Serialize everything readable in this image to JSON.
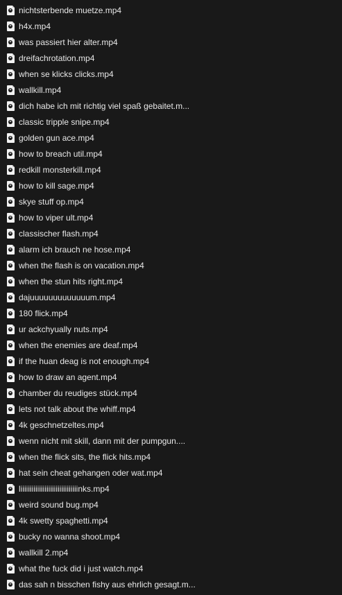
{
  "files": [
    {
      "name": "nichtsterbende muetze.mp4",
      "icon": "video-file-icon"
    },
    {
      "name": "h4x.mp4",
      "icon": "video-file-icon"
    },
    {
      "name": "was passiert hier alter.mp4",
      "icon": "video-file-icon"
    },
    {
      "name": "dreifachrotation.mp4",
      "icon": "video-file-icon"
    },
    {
      "name": "when se klicks clicks.mp4",
      "icon": "video-file-icon"
    },
    {
      "name": "wallkill.mp4",
      "icon": "video-file-icon"
    },
    {
      "name": "dich habe ich mit richtig viel spaß gebaitet.m...",
      "icon": "video-file-icon"
    },
    {
      "name": "classic tripple snipe.mp4",
      "icon": "video-file-icon"
    },
    {
      "name": "golden gun ace.mp4",
      "icon": "video-file-icon"
    },
    {
      "name": "how to breach util.mp4",
      "icon": "video-file-icon"
    },
    {
      "name": "redkill monsterkill.mp4",
      "icon": "video-file-icon"
    },
    {
      "name": "how to kill sage.mp4",
      "icon": "video-file-icon"
    },
    {
      "name": "skye stuff op.mp4",
      "icon": "video-file-icon"
    },
    {
      "name": "how to viper ult.mp4",
      "icon": "video-file-icon"
    },
    {
      "name": "classischer flash.mp4",
      "icon": "video-file-icon"
    },
    {
      "name": "alarm ich brauch ne hose.mp4",
      "icon": "video-file-icon"
    },
    {
      "name": "when the flash is on vacation.mp4",
      "icon": "video-file-icon"
    },
    {
      "name": "when the stun hits right.mp4",
      "icon": "video-file-icon"
    },
    {
      "name": "dajuuuuuuuuuuuuum.mp4",
      "icon": "video-file-icon"
    },
    {
      "name": "180 flick.mp4",
      "icon": "video-file-icon"
    },
    {
      "name": "ur ackchyually nuts.mp4",
      "icon": "video-file-icon"
    },
    {
      "name": "when the enemies are deaf.mp4",
      "icon": "video-file-icon"
    },
    {
      "name": "if the huan deag is not enough.mp4",
      "icon": "video-file-icon"
    },
    {
      "name": "how to draw an agent.mp4",
      "icon": "video-file-icon"
    },
    {
      "name": "chamber du reudiges stück.mp4",
      "icon": "video-file-icon"
    },
    {
      "name": "lets not talk about the whiff.mp4",
      "icon": "video-file-icon"
    },
    {
      "name": "4k geschnetzeltes.mp4",
      "icon": "video-file-icon"
    },
    {
      "name": "wenn nicht mit skill, dann mit der pumpgun....",
      "icon": "video-file-icon"
    },
    {
      "name": "when the flick sits, the flick hits.mp4",
      "icon": "video-file-icon"
    },
    {
      "name": "hat sein cheat gehangen oder wat.mp4",
      "icon": "video-file-icon"
    },
    {
      "name": "liiiiiiiiiiiiiiiiiiiiiiiiiiiiiiinks.mp4",
      "icon": "video-file-icon"
    },
    {
      "name": "weird sound bug.mp4",
      "icon": "video-file-icon"
    },
    {
      "name": "4k swetty spaghetti.mp4",
      "icon": "video-file-icon"
    },
    {
      "name": "bucky no wanna shoot.mp4",
      "icon": "video-file-icon"
    },
    {
      "name": "wallkill 2.mp4",
      "icon": "video-file-icon"
    },
    {
      "name": "what the fuck did i just watch.mp4",
      "icon": "video-file-icon"
    },
    {
      "name": "das sah n bisschen fishy aus ehrlich gesagt.m...",
      "icon": "video-file-icon"
    }
  ],
  "colors": {
    "background": "#191919",
    "text": "#e8e8e8",
    "icon": "#f2f2f2"
  }
}
